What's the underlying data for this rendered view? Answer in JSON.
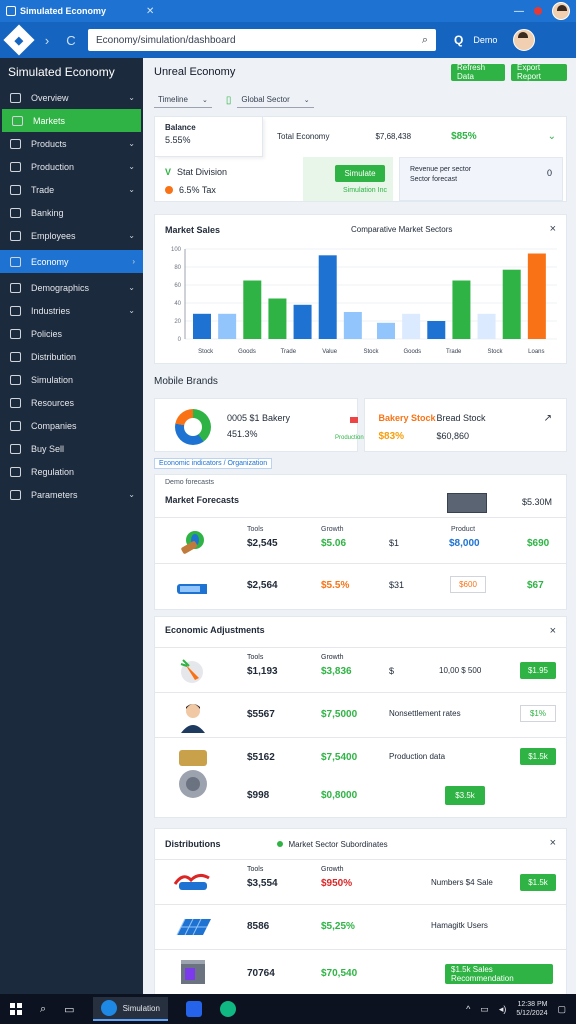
{
  "window": {
    "title": "Simulated Economy",
    "close_glyph": "✕",
    "min_glyph": "—",
    "user_label": "Demo"
  },
  "addressbar": {
    "url": "Economy/simulation/dashboard",
    "back": "›",
    "reload": "C",
    "search_glyph": "⌕",
    "q": "Q"
  },
  "sidebar": {
    "brand": "Simulated Economy",
    "items": [
      {
        "label": "Overview",
        "chev": "⌄"
      },
      {
        "label": "Markets",
        "chev": ""
      },
      {
        "label": "Products",
        "chev": "⌄"
      },
      {
        "label": "Production",
        "chev": "⌄"
      },
      {
        "label": "Trade",
        "chev": "⌄"
      },
      {
        "label": "Banking",
        "chev": ""
      },
      {
        "label": "Employees",
        "chev": "⌄"
      },
      {
        "label": "Economy",
        "chev": "›"
      },
      {
        "label": "Demographics",
        "chev": "⌄"
      },
      {
        "label": "Industries",
        "chev": "⌄"
      },
      {
        "label": "Policies",
        "chev": ""
      },
      {
        "label": "Distribution",
        "chev": ""
      },
      {
        "label": "Simulation",
        "chev": ""
      },
      {
        "label": "Resources",
        "chev": ""
      },
      {
        "label": "Companies",
        "chev": ""
      },
      {
        "label": "Buy Sell",
        "chev": ""
      },
      {
        "label": "Regulation",
        "chev": ""
      },
      {
        "label": "Parameters",
        "chev": "⌄"
      }
    ]
  },
  "main": {
    "title": "Unreal Economy",
    "btn1": "Refresh Data",
    "btn2": "Export Report",
    "select1": "Timeline",
    "select2": "Global Sector",
    "chev": "⌄",
    "filter_icon": "▯"
  },
  "summary": {
    "left_title": "Balance",
    "left_value": "5.55%",
    "row_label": "Total Economy",
    "row_value": "$7,68,438",
    "row_pct": "$85%",
    "chev": "⌄",
    "stat1_label": "Stat Division",
    "stat1_check": "V",
    "stat2_label": "6.5% Tax",
    "green_btn": "Simulate",
    "green_label": "Simulation Inc",
    "blue_l1": "Revenue per sector",
    "blue_l2": "Sector forecast",
    "blue_val": "0"
  },
  "chart_card": {
    "title": "Market Sales",
    "subtitle": "Comparative Market Sectors",
    "close": "×"
  },
  "chart_data": {
    "type": "bar",
    "ylim": [
      0,
      100
    ],
    "yticks": [
      "0",
      "20",
      "40",
      "60",
      "80",
      "100"
    ],
    "categories": [
      "Stock",
      "Goods",
      "Trade",
      "Value",
      "Stock",
      "Goods",
      "Trade",
      "Stock",
      "Loans"
    ],
    "series": [
      {
        "values": [
          28,
          28,
          65,
          45,
          38,
          93,
          30,
          18,
          28,
          20,
          65,
          28,
          77,
          95
        ]
      }
    ],
    "colors": [
      "#1e73d2",
      "#93c5fd",
      "#2fb344",
      "#2fb344",
      "#1e73d2",
      "#1e73d2",
      "#93c5fd",
      "#93c5fd",
      "#dbeafe",
      "#1e73d2",
      "#2fb344",
      "#dbeafe",
      "#2fb344",
      "#f97316"
    ],
    "grid": true
  },
  "metrics": {
    "title": "Mobile Brands",
    "card1_a": "0005 $1 Bakery",
    "card1_b": "451.3%",
    "card1_tiny": "Production",
    "card2_a": "Bakery Stock",
    "card2_b": "$83%",
    "card2_c": "Bread Stock",
    "card2_d": "$60,860",
    "arrow": "↗"
  },
  "tabstrip": {
    "tab": "Economic indicators / Organization"
  },
  "table1": {
    "sub": "Demo forecasts",
    "title": "Market Forecasts",
    "hdr_val": "$5.30M",
    "rows": [
      {
        "lbl1": "Tools",
        "v1": "$2,545",
        "lbl2": "Growth",
        "v2": "$5.06",
        "t": "$1",
        "lbl3": "Product",
        "v3": "$8,000",
        "v4": "$690"
      },
      {
        "lbl1": "",
        "v1": "$2,564",
        "lbl2": "",
        "v2": "$5.5%",
        "t": "$31",
        "lbl3": "",
        "v3": "$600",
        "v4": "$67"
      }
    ]
  },
  "table2": {
    "title": "Economic Adjustments",
    "close": "×",
    "rows": [
      {
        "lbl1": "Tools",
        "v1": "$1,193",
        "lbl2": "Growth",
        "v2": "$3,836",
        "t1": "$",
        "t2": "10,00 $ 500",
        "btn": "$1.95"
      },
      {
        "lbl1": "",
        "v1": "$5567",
        "lbl2": "",
        "v2": "$7,5000",
        "t1": "Nonsettlement rates",
        "t2": "",
        "btn": "$1%"
      },
      {
        "lbl1": "",
        "v1": "$5162",
        "lbl2": "",
        "v2": "$7,5400",
        "t1": "Production data",
        "t2": "",
        "btn": "$1.5k"
      },
      {
        "lbl1": "",
        "v1": "$998",
        "lbl2": "",
        "v2": "$0,8000",
        "t1": "",
        "t2": "",
        "btn": "$3.5k"
      }
    ]
  },
  "table3": {
    "title": "Distributions",
    "sub": "Market Sector Subordinates",
    "close": "×",
    "rows": [
      {
        "lbl1": "Tools",
        "v1": "$3,554",
        "lbl2": "Growth",
        "v2": "$950%",
        "t": "Numbers $4 Sale",
        "btn": "$1.5k"
      },
      {
        "lbl1": "",
        "v1": "8586",
        "lbl2": "",
        "v2": "$5,25%",
        "t": "Hamagitk Users",
        "btn": ""
      },
      {
        "lbl1": "",
        "v1": "70764",
        "lbl2": "",
        "v2": "$70,540",
        "t": "",
        "btn": "$1.5k   Sales Recommendation"
      }
    ]
  },
  "taskbar": {
    "app": "Simulation",
    "time": "12:38 PM",
    "date": "5/12/2024",
    "up": "^"
  }
}
